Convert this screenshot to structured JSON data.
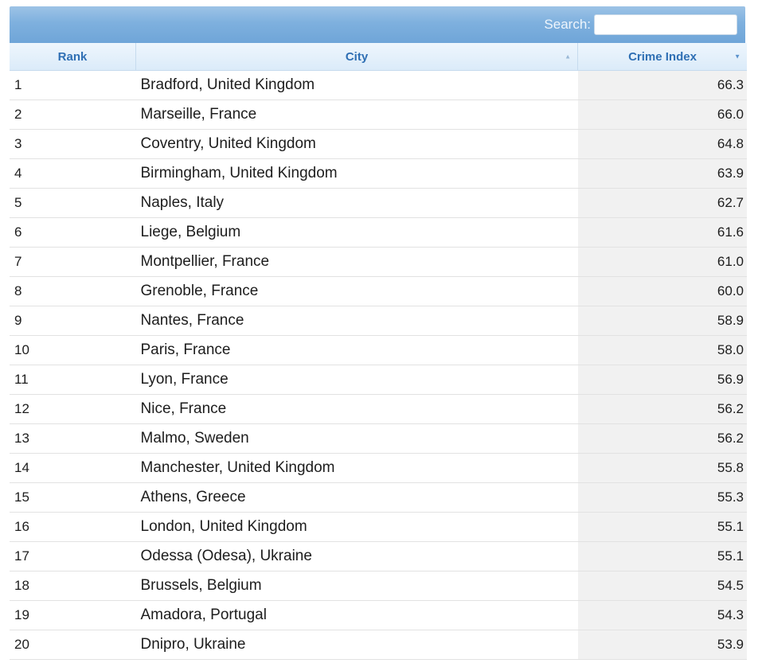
{
  "search": {
    "label": "Search:",
    "value": "",
    "placeholder": ""
  },
  "columns": {
    "rank": "Rank",
    "city": "City",
    "crime_index": "Crime Index"
  },
  "sort": {
    "city_indicator": "▲",
    "crime_indicator": "▼"
  },
  "rows": [
    {
      "rank": "1",
      "city": "Bradford, United Kingdom",
      "crime_index": "66.3"
    },
    {
      "rank": "2",
      "city": "Marseille, France",
      "crime_index": "66.0"
    },
    {
      "rank": "3",
      "city": "Coventry, United Kingdom",
      "crime_index": "64.8"
    },
    {
      "rank": "4",
      "city": "Birmingham, United Kingdom",
      "crime_index": "63.9"
    },
    {
      "rank": "5",
      "city": "Naples, Italy",
      "crime_index": "62.7"
    },
    {
      "rank": "6",
      "city": "Liege, Belgium",
      "crime_index": "61.6"
    },
    {
      "rank": "7",
      "city": "Montpellier, France",
      "crime_index": "61.0"
    },
    {
      "rank": "8",
      "city": "Grenoble, France",
      "crime_index": "60.0"
    },
    {
      "rank": "9",
      "city": "Nantes, France",
      "crime_index": "58.9"
    },
    {
      "rank": "10",
      "city": "Paris, France",
      "crime_index": "58.0"
    },
    {
      "rank": "11",
      "city": "Lyon, France",
      "crime_index": "56.9"
    },
    {
      "rank": "12",
      "city": "Nice, France",
      "crime_index": "56.2"
    },
    {
      "rank": "13",
      "city": "Malmo, Sweden",
      "crime_index": "56.2"
    },
    {
      "rank": "14",
      "city": "Manchester, United Kingdom",
      "crime_index": "55.8"
    },
    {
      "rank": "15",
      "city": "Athens, Greece",
      "crime_index": "55.3"
    },
    {
      "rank": "16",
      "city": "London, United Kingdom",
      "crime_index": "55.1"
    },
    {
      "rank": "17",
      "city": "Odessa (Odesa), Ukraine",
      "crime_index": "55.1"
    },
    {
      "rank": "18",
      "city": "Brussels, Belgium",
      "crime_index": "54.5"
    },
    {
      "rank": "19",
      "city": "Amadora, Portugal",
      "crime_index": "54.3"
    },
    {
      "rank": "20",
      "city": "Dnipro, Ukraine",
      "crime_index": "53.9"
    }
  ]
}
